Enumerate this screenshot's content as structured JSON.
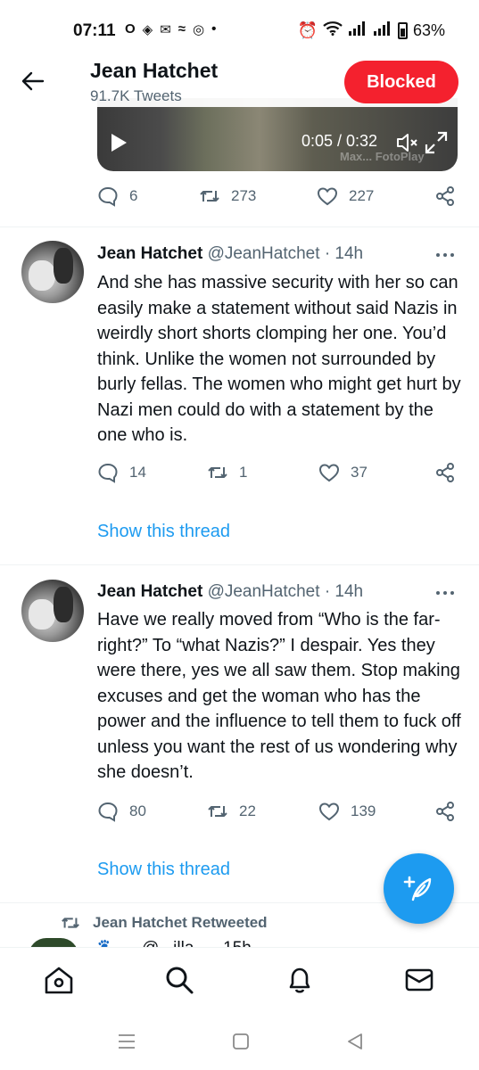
{
  "status_bar": {
    "time": "07:11",
    "left_icons": [
      "O",
      "◈",
      "✉",
      "≈",
      "◎",
      "•"
    ],
    "battery": "63%"
  },
  "header": {
    "name": "Jean Hatchet",
    "tweets_count": "91.7K Tweets",
    "blocked_label": "Blocked"
  },
  "video": {
    "time": "0:05 / 0:32",
    "watermark": "Max... FotoPlay"
  },
  "video_tweet_actions": {
    "replies": "6",
    "retweets": "273",
    "likes": "227"
  },
  "tweets": [
    {
      "name": "Jean Hatchet",
      "handle": "@JeanHatchet",
      "time": "· 14h",
      "text": "And she has massive security with her so can easily make a statement without said Nazis in weirdly short shorts clomping her one. You’d think. Unlike the women not surrounded by burly fellas. The women who might get hurt by Nazi men could do with a statement by the one who is.",
      "replies": "14",
      "retweets": "1",
      "likes": "37",
      "show_thread": "Show this thread"
    },
    {
      "name": "Jean Hatchet",
      "handle": "@JeanHatchet",
      "time": "· 14h",
      "text": "Have we really moved from “Who is the far-right?” To “what Nazis?” I despair. Yes they were there, yes we all saw them. Stop making excuses and get the woman who has the power and the influence to tell them to fuck off unless you want the rest of us wondering why she doesn’t.",
      "replies": "80",
      "retweets": "22",
      "likes": "139",
      "show_thread": "Show this thread"
    }
  ],
  "retweeted_label": "Jean Hatchet Retweeted",
  "partial_next": "🐾 ... @...illa... · 15h",
  "colors": {
    "accent": "#1d9bf0",
    "blocked": "#f4212e",
    "secondary_text": "#536471",
    "primary_text": "#0f1419"
  },
  "icons": {
    "back": "arrow-left-icon",
    "reply": "reply-icon",
    "retweet": "retweet-icon",
    "like": "heart-icon",
    "share": "share-icon",
    "more": "more-icon",
    "compose": "compose-icon",
    "home": "home-icon",
    "search": "search-icon",
    "notifications": "bell-icon",
    "messages": "mail-icon"
  }
}
